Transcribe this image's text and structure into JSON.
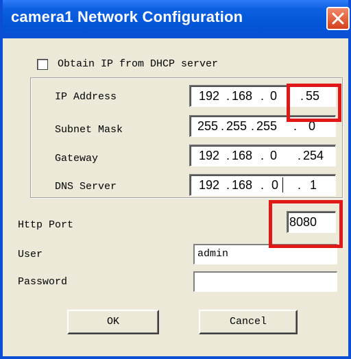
{
  "window": {
    "title": "camera1 Network Configuration",
    "close_icon": "close-icon"
  },
  "dhcp": {
    "label": "Obtain IP from DHCP server",
    "checked": false
  },
  "network": {
    "ip_label": "IP Address",
    "ip": [
      "192",
      "168",
      "0",
      "55"
    ],
    "subnet_label": "Subnet Mask",
    "subnet": [
      "255",
      "255",
      "255",
      "0"
    ],
    "gateway_label": "Gateway",
    "gateway": [
      "192",
      "168",
      "0",
      "254"
    ],
    "dns_label": "DNS Server",
    "dns": [
      "192",
      "168",
      "0",
      "1"
    ]
  },
  "http": {
    "label": "Http Port",
    "value": "8080"
  },
  "user": {
    "label": "User",
    "value": "admin"
  },
  "password": {
    "label": "Password",
    "value": ""
  },
  "buttons": {
    "ok": "OK",
    "cancel": "Cancel"
  },
  "colors": {
    "highlight": "#e01818",
    "titlebar": "#0a4fd6"
  }
}
